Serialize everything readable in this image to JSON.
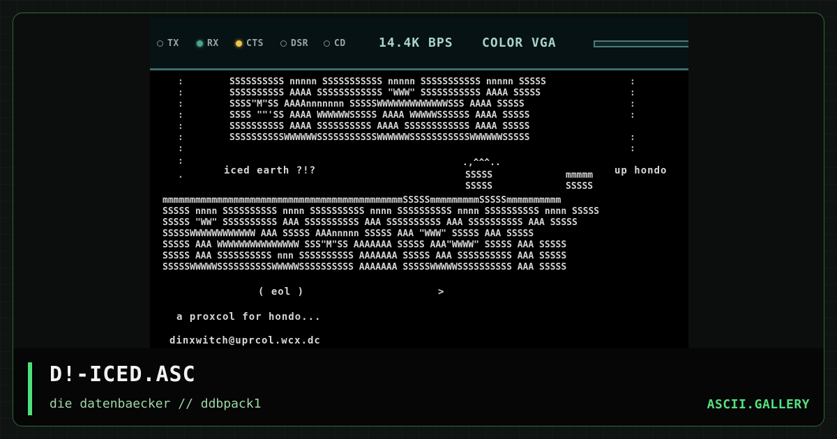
{
  "status_bar": {
    "indicators": [
      {
        "label": "TX",
        "state": "off"
      },
      {
        "label": "RX",
        "state": "on",
        "color": "#4ba58a"
      },
      {
        "label": "CTS",
        "state": "on",
        "color": "#f0c34a"
      },
      {
        "label": "DSR",
        "state": "off"
      },
      {
        "label": "CD",
        "state": "off"
      }
    ],
    "speed": "14.4K BPS",
    "mode": "COLOR VGA"
  },
  "artwork": {
    "tagline": "iced earth ?!?",
    "side_text": "up hondo",
    "caption": "( eol )",
    "arrow": ">",
    "line1": "a proxcol for hondo...",
    "line2": "dinxwitch@uprcol.wcx.dc"
  },
  "footer": {
    "title": "D!-ICED.ASC",
    "subtitle": "die datenbaecker // ddbpack1",
    "brand": "ASCII.GALLERY",
    "accent_color": "#4ee07a"
  }
}
